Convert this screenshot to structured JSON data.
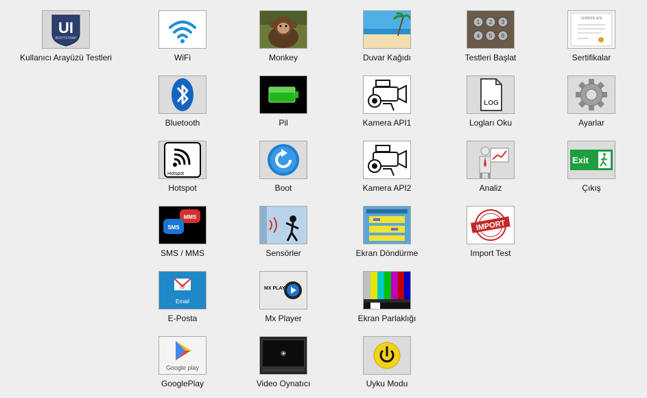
{
  "tiles": {
    "ui_tests": "Kullanıcı Arayüzü Testleri",
    "wifi": "WiFi",
    "monkey": "Monkey",
    "wallpaper": "Duvar Kağıdı",
    "start_tests": "Testleri Başlat",
    "certificates": "Sertifikalar",
    "bluetooth": "Bluetooth",
    "battery": "Pil",
    "camera1": "Kamera API1",
    "read_logs": "Logları Oku",
    "settings": "Ayarlar",
    "hotspot": "Hotspot",
    "boot": "Boot",
    "camera2": "Kamera API2",
    "analysis": "Analiz",
    "exit": "Çıkış",
    "sms_mms": "SMS / MMS",
    "sensors": "Sensörler",
    "screen_rotation": "Ekran Döndürme",
    "import_test": "Import Test",
    "email": "E-Posta",
    "mx_player": "Mx Player",
    "screen_brightness": "Ekran Parlaklığı",
    "google_play": "GooglePlay",
    "video_player": "Video Oynatıcı",
    "sleep_mode": "Uyku Modu"
  },
  "icon_text": {
    "ui_logo": "UI",
    "ui_logo_sub": "BOOTSTRAP",
    "certificate": "CERTIFICATE",
    "log": "LOG",
    "exit_sign": "Exit",
    "hotspot_caption": "Hotspot",
    "import_stamp": "IMPORT",
    "email_caption": "Email",
    "mx_player_logo": "MX PLAYER",
    "google_play_text": "Google play",
    "mms": "MMS",
    "sms": "SMS"
  },
  "colors": {
    "background": "#eeeeee",
    "tile_border": "#a9a9a9",
    "tile_bg": "#dcdcdc"
  }
}
